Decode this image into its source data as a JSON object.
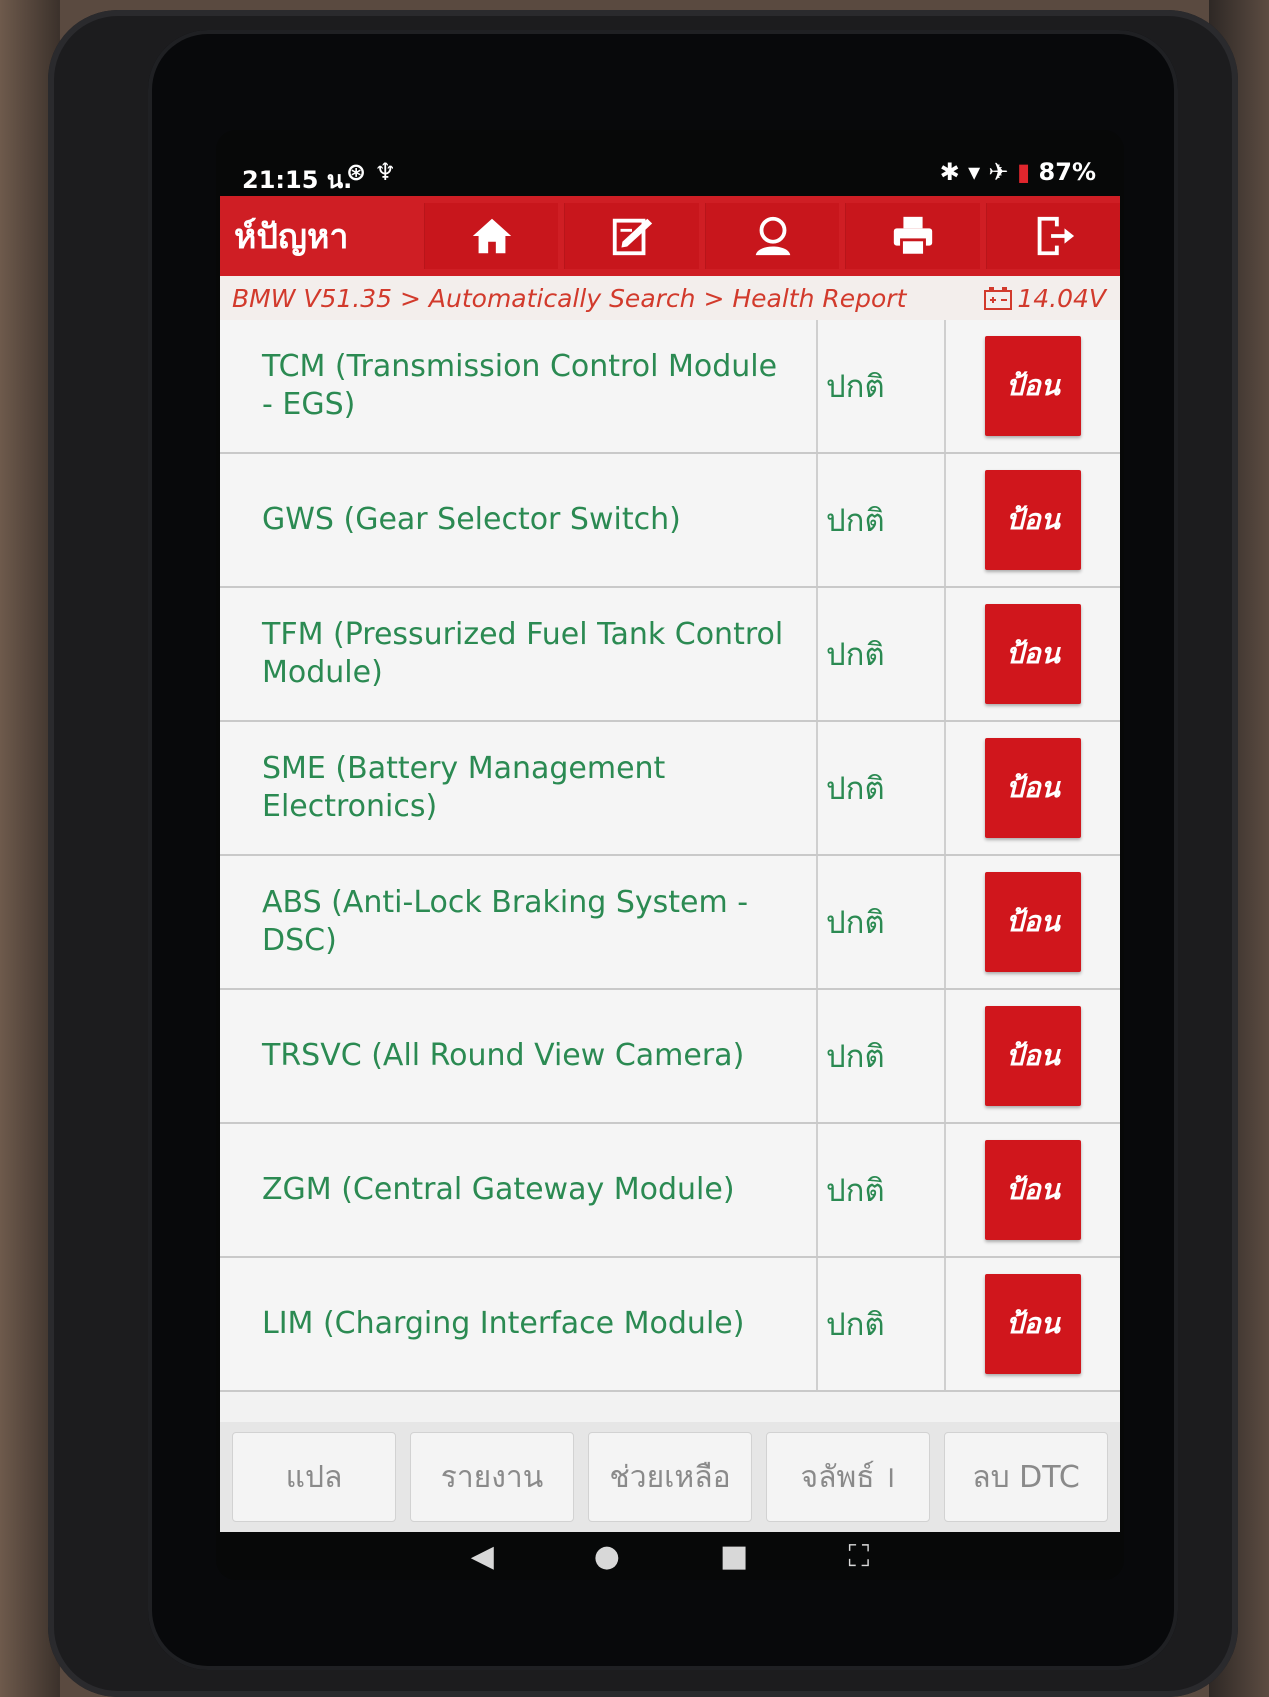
{
  "status_bar": {
    "time": "21:15 น.",
    "left_icons": "⊛ ♆",
    "right_icons": "✱ ▾ ✈",
    "battery": "87%"
  },
  "app_bar": {
    "title": "ห์ปัญหา",
    "tools": [
      "home-icon",
      "edit-icon",
      "user-icon",
      "print-icon",
      "exit-icon"
    ]
  },
  "breadcrumb": {
    "path": "BMW V51.35 > Automatically Search > Health Report",
    "voltage": "14.04V"
  },
  "modules": [
    {
      "name": "TCM (Transmission Control Module - EGS)",
      "status": "ปกติ",
      "action": "ป้อน"
    },
    {
      "name": "GWS (Gear Selector Switch)",
      "status": "ปกติ",
      "action": "ป้อน"
    },
    {
      "name": "TFM (Pressurized Fuel Tank Control Module)",
      "status": "ปกติ",
      "action": "ป้อน"
    },
    {
      "name": "SME (Battery Management Electronics)",
      "status": "ปกติ",
      "action": "ป้อน"
    },
    {
      "name": "ABS (Anti-Lock Braking System - DSC)",
      "status": "ปกติ",
      "action": "ป้อน"
    },
    {
      "name": "TRSVC (All Round View Camera)",
      "status": "ปกติ",
      "action": "ป้อน"
    },
    {
      "name": "ZGM (Central Gateway Module)",
      "status": "ปกติ",
      "action": "ป้อน"
    },
    {
      "name": "LIM (Charging Interface Module)",
      "status": "ปกติ",
      "action": "ป้อน"
    }
  ],
  "bottom_buttons": [
    "แปล",
    "รายงาน",
    "ช่วยเหลือ",
    "จลัพธ์ ।",
    "ลบ DTC"
  ],
  "nav": [
    "◀",
    "●",
    "■",
    "⛶"
  ],
  "colors": {
    "accent": "#cf1e24",
    "ok_text": "#2b8a52",
    "crumb": "#d23a2c"
  }
}
